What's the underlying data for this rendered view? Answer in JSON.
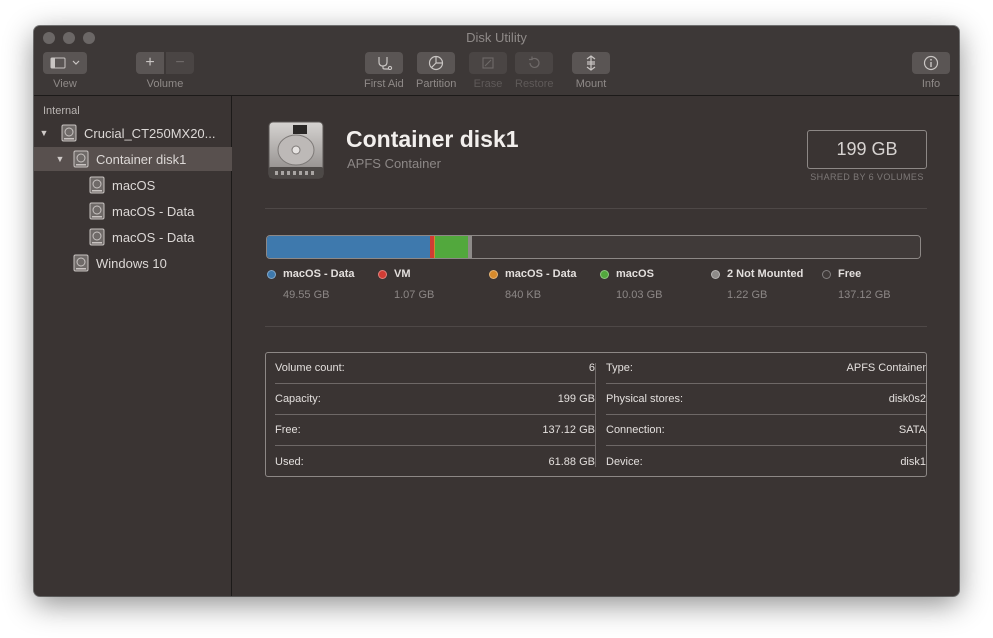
{
  "window": {
    "title": "Disk Utility"
  },
  "toolbar": {
    "view_label": "View",
    "volume_label": "Volume",
    "volume_add": "+",
    "volume_remove": "−",
    "first_aid_label": "First Aid",
    "partition_label": "Partition",
    "erase_label": "Erase",
    "restore_label": "Restore",
    "mount_label": "Mount",
    "info_label": "Info"
  },
  "sidebar": {
    "header": "Internal",
    "items": [
      {
        "label": "Crucial_CT250MX20...",
        "expanded": true
      },
      {
        "label": "Container disk1",
        "expanded": true,
        "selected": true
      },
      {
        "label": "macOS"
      },
      {
        "label": "macOS - Data"
      },
      {
        "label": "macOS - Data"
      },
      {
        "label": "Windows 10"
      }
    ]
  },
  "container": {
    "title": "Container disk1",
    "subtitle": "APFS Container",
    "size": "199 GB",
    "shared": "SHARED BY 6 VOLUMES"
  },
  "usage": {
    "colors": {
      "blue": "#3e79ad",
      "red": "#d13c34",
      "orange": "#d68a2c",
      "green": "#52a83d",
      "gray": "#8e8b89",
      "free": "#403a39"
    },
    "legend": [
      {
        "name": "macOS - Data",
        "value": "49.55 GB",
        "color": "#3e79ad",
        "fraction": 0.249
      },
      {
        "name": "VM",
        "value": "1.07 GB",
        "color": "#d13c34",
        "fraction": 0.0054
      },
      {
        "name": "macOS - Data",
        "value": "840 KB",
        "color": "#d68a2c",
        "fraction": 0.0
      },
      {
        "name": "macOS",
        "value": "10.03 GB",
        "color": "#52a83d",
        "fraction": 0.0504
      },
      {
        "name": "2 Not Mounted",
        "value": "1.22 GB",
        "color": "#8e8b89",
        "fraction": 0.0061
      },
      {
        "name": "Free",
        "value": "137.12 GB",
        "color": "#403a39",
        "fraction": 0.689
      }
    ]
  },
  "info": {
    "left": [
      {
        "label": "Volume count:",
        "value": "6"
      },
      {
        "label": "Capacity:",
        "value": "199 GB"
      },
      {
        "label": "Free:",
        "value": "137.12 GB"
      },
      {
        "label": "Used:",
        "value": "61.88 GB"
      }
    ],
    "right": [
      {
        "label": "Type:",
        "value": "APFS Container"
      },
      {
        "label": "Physical stores:",
        "value": "disk0s2"
      },
      {
        "label": "Connection:",
        "value": "SATA"
      },
      {
        "label": "Device:",
        "value": "disk1"
      }
    ]
  }
}
